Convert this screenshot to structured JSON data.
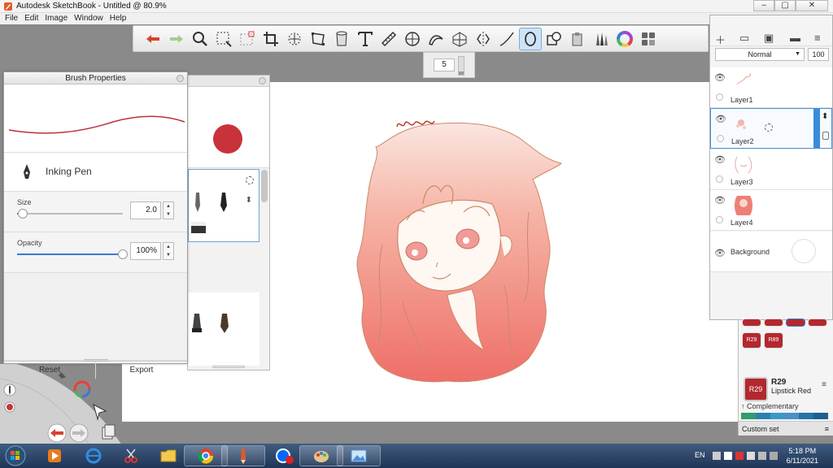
{
  "window": {
    "title": "Autodesk SketchBook - Untitled @ 80.9%",
    "minimize": "–",
    "maximize": "▢",
    "close": "✕"
  },
  "menu": [
    "File",
    "Edit",
    "Image",
    "Window",
    "Help"
  ],
  "brush_size_popup": {
    "value": "5"
  },
  "brush_properties": {
    "title": "Brush Properties",
    "brush_name": "Inking Pen",
    "size": {
      "label": "Size",
      "value": "2.0",
      "fraction": 0.05
    },
    "opacity": {
      "label": "Opacity",
      "value": "100%",
      "fraction": 1.0
    },
    "reset_label": "Reset",
    "export_label": "Export"
  },
  "brush_library": {
    "current_color": "#c8323a"
  },
  "layers": {
    "blend_mode": "Normal",
    "opacity": "100",
    "items": [
      {
        "name": "Layer1"
      },
      {
        "name": "Layer2"
      },
      {
        "name": "Layer3"
      },
      {
        "name": "Layer4"
      }
    ],
    "background_label": "Background"
  },
  "colors": {
    "chips": [
      "R29",
      "R89"
    ],
    "current": {
      "code": "R29",
      "name": "Lipstick Red",
      "hex": "#b3282e"
    },
    "complementary_label": "↑ Complementary",
    "complementary_colors": [
      "#2e9e6b",
      "#2d7fb3",
      "#3a98c9",
      "#4b8fc7",
      "#2474a8",
      "#1c5f8f"
    ],
    "custom_set_label": "Custom set"
  },
  "taskbar": {
    "language": "EN",
    "time": "5:18 PM",
    "date": "6/11/2021"
  }
}
